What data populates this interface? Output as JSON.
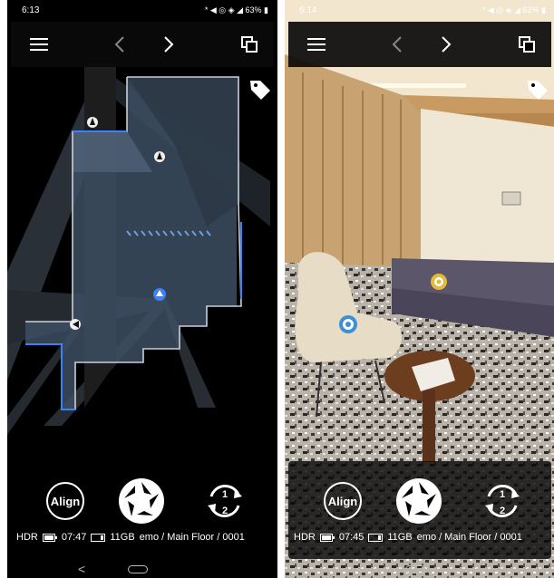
{
  "screens": [
    {
      "status": {
        "time": "6:13",
        "battery": "63%",
        "icons": "* ◀ ◎ ◈ ◢"
      },
      "info": {
        "mode": "HDR",
        "battery_time": "07:47",
        "storage": "11GB",
        "path": "emo / Main Floor / 0001"
      },
      "controls": {
        "align_label": "Align",
        "swap_top": "1",
        "swap_bottom": "2"
      }
    },
    {
      "status": {
        "time": "6:14",
        "battery": "62%",
        "icons": "* ◀ ◎ ◈ ◢"
      },
      "info": {
        "mode": "HDR",
        "battery_time": "07:45",
        "storage": "11GB",
        "path": "emo / Main Floor / 0001"
      },
      "controls": {
        "align_label": "Align",
        "swap_top": "1",
        "swap_bottom": "2"
      }
    }
  ],
  "icons": {
    "menu": "hamburger-menu-icon",
    "prev": "chevron-left-icon",
    "next": "chevron-right-icon",
    "copy": "copy-windows-icon",
    "tag": "tag-icon",
    "shutter": "aperture-shutter-icon",
    "swap": "rotate-1-2-icon"
  },
  "colors": {
    "accent": "#3b82f6",
    "scan_point": "#4a90e2",
    "tag_marker": "#e6b93c"
  }
}
